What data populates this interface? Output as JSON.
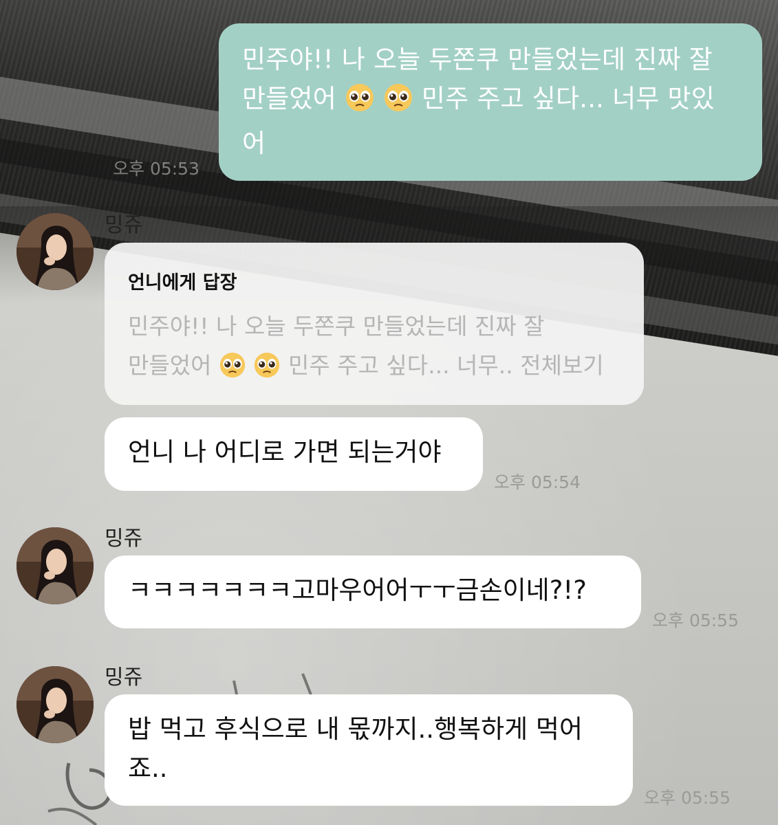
{
  "colors": {
    "outgoing_bubble": "#a3d0c5",
    "incoming_bubble": "#ffffff",
    "reply_quote_text": "#b5b5b5",
    "timestamp": "#9a9a98"
  },
  "outgoing": {
    "line1": "민주야!! 나 오늘 두쫀쿠 만들었는데 진짜 잘",
    "line2_pre": "만들었어",
    "line2_post": "민주 주고 싶다... 너무 맛있",
    "line3": "어",
    "emoji": "pleading-face-emoji",
    "time": "오후 05:53"
  },
  "incoming": [
    {
      "sender": "밍쥬",
      "avatar": "profile-avatar",
      "reply_header": "언니에게 답장",
      "quote_line1": "민주야!! 나 오늘 두쫀쿠 만들었는데 진짜 잘",
      "quote_line2_pre": "만들었어",
      "quote_line2_post": "민주 주고 싶다... 너무.. 전체보기",
      "text": "언니 나 어디로 가면 되는거야",
      "time": "오후 05:54"
    },
    {
      "sender": "밍쥬",
      "avatar": "profile-avatar",
      "text": "ㅋㅋㅋㅋㅋㅋㅋ고마우어어ㅜㅜ금손이네?!?",
      "time": "오후 05:55"
    },
    {
      "sender": "밍쥬",
      "avatar": "profile-avatar",
      "line1": "밥 먹고 후식으로 내 몫까지..행복하게 먹어",
      "line2": "죠..",
      "time": "오후 05:55"
    }
  ]
}
